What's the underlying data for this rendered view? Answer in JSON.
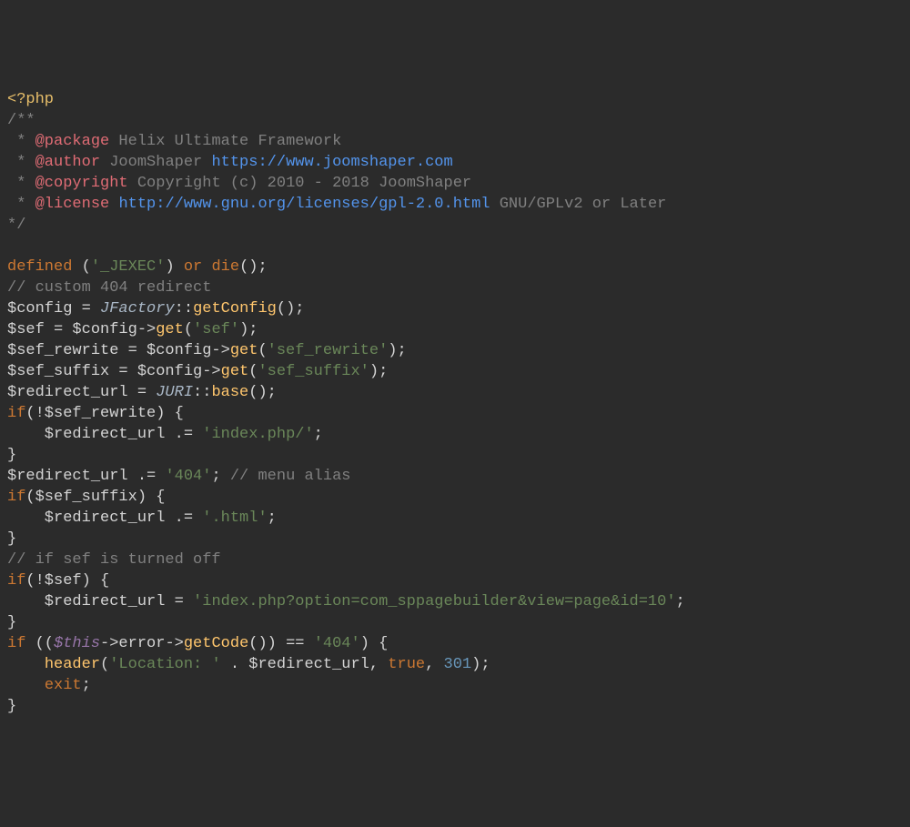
{
  "lines": {
    "l1_open": "<?php",
    "l2": "/**",
    "l3_star": " * ",
    "l3_tag": "@package",
    "l3_text": " Helix Ultimate Framework",
    "l4_star": " * ",
    "l4_tag": "@author",
    "l4_text": " JoomShaper ",
    "l4_link": "https://www.joomshaper.com",
    "l5_star": " * ",
    "l5_tag": "@copyright",
    "l5_text": " Copyright (c) 2010 - 2018 JoomShaper",
    "l6_star": " * ",
    "l6_tag": "@license",
    "l6_sp": " ",
    "l6_link": "http://www.gnu.org/licenses/gpl-2.0.html",
    "l6_text": " GNU/GPLv2 or Later",
    "l7": "*/",
    "l8_defined": "defined ",
    "l8_p1": "(",
    "l8_str": "'_JEXEC'",
    "l8_p2": ") ",
    "l8_or": "or ",
    "l8_die": "die",
    "l8_p3": "();",
    "l9_comment": "// custom 404 redirect",
    "l10_a": "$config = ",
    "l10_cls": "JFactory",
    "l10_b": "::",
    "l10_fn": "getConfig",
    "l10_c": "();",
    "l11_a": "$sef = $config->",
    "l11_fn": "get",
    "l11_b": "(",
    "l11_str": "'sef'",
    "l11_c": ");",
    "l12_a": "$sef_rewrite = $config->",
    "l12_fn": "get",
    "l12_b": "(",
    "l12_str": "'sef_rewrite'",
    "l12_c": ");",
    "l13_a": "$sef_suffix = $config->",
    "l13_fn": "get",
    "l13_b": "(",
    "l13_str": "'sef_suffix'",
    "l13_c": ");",
    "l14_a": "$redirect_url = ",
    "l14_cls": "JURI",
    "l14_b": "::",
    "l14_fn": "base",
    "l14_c": "();",
    "l15_if": "if",
    "l15_a": "(!$sef_rewrite) {",
    "l16_a": "    $redirect_url .= ",
    "l16_str": "'index.php/'",
    "l16_b": ";",
    "l17": "}",
    "l18_a": "$redirect_url .= ",
    "l18_str": "'404'",
    "l18_b": "; ",
    "l18_comment": "// menu alias",
    "l19_if": "if",
    "l19_a": "($sef_suffix) {",
    "l20_a": "    $redirect_url .= ",
    "l20_str": "'.html'",
    "l20_b": ";",
    "l21": "}",
    "l22_comment": "// if sef is turned off",
    "l23_if": "if",
    "l23_a": "(!$sef) {",
    "l24_a": "    $redirect_url = ",
    "l24_str": "'index.php?option=com_sppagebuilder&view=page&id=10'",
    "l24_b": ";",
    "l25": "}",
    "l26_if": "if ",
    "l26_a": "((",
    "l26_this": "$this",
    "l26_b": "->error->",
    "l26_fn": "getCode",
    "l26_c": "()) == ",
    "l26_str": "'404'",
    "l26_d": ") {",
    "l27_a": "    ",
    "l27_fn": "header",
    "l27_b": "(",
    "l27_str": "'Location: '",
    "l27_c": " . $redirect_url, ",
    "l27_true": "true",
    "l27_d": ", ",
    "l27_num": "301",
    "l27_e": ");",
    "l28_a": "    ",
    "l28_exit": "exit",
    "l28_b": ";",
    "l29": "}"
  }
}
